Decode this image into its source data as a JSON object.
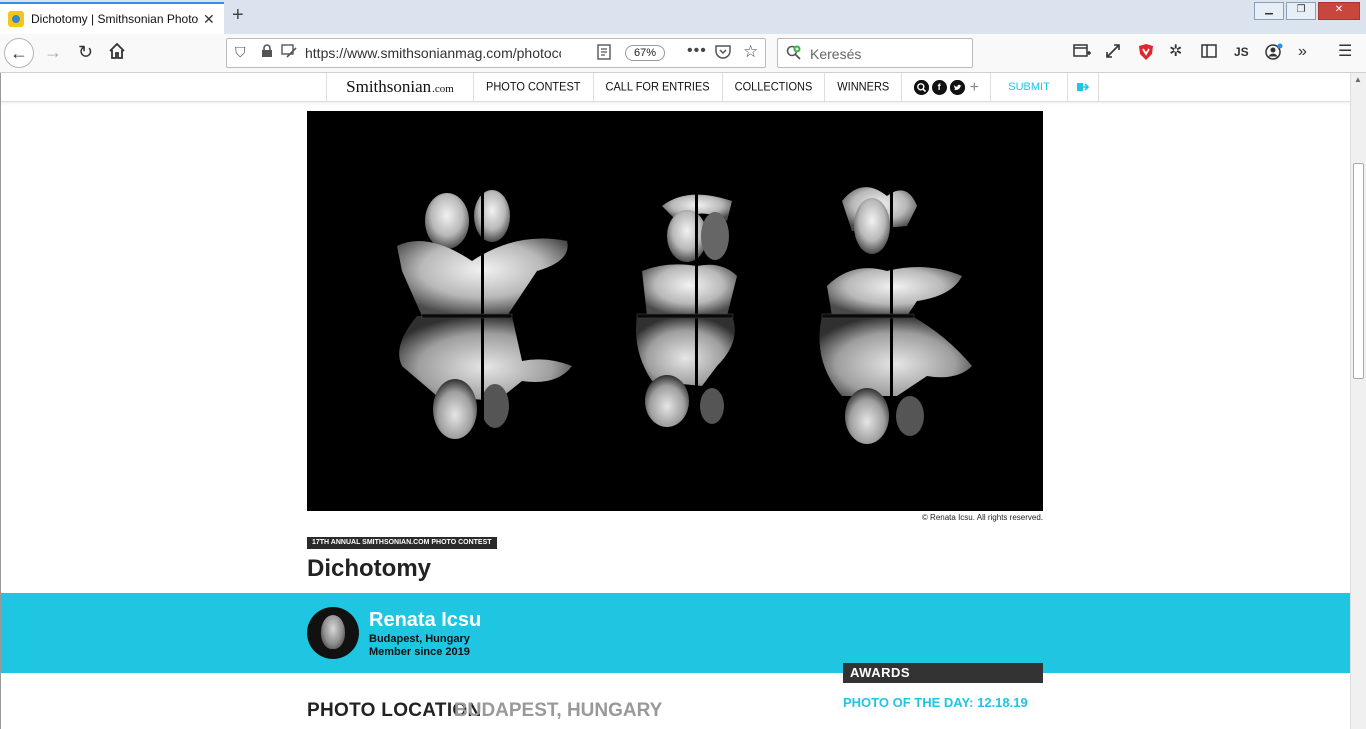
{
  "browser": {
    "tab_title": "Dichotomy | Smithsonian Photo Contest",
    "tab_close": "✕",
    "new_tab": "+",
    "url": "https://www.smithsonianmag.com/photocontest/detail/dichotomy/",
    "zoom": "67%",
    "search_placeholder": "Keresés",
    "profile_initials": "JS",
    "window_minimize": "▁",
    "window_restore": "❐",
    "window_close": "✕"
  },
  "site_nav": {
    "brand": "Smithsonian",
    "brand_suffix": ".com",
    "items": [
      "PHOTO CONTEST",
      "CALL FOR ENTRIES",
      "COLLECTIONS",
      "WINNERS"
    ],
    "submit": "SUBMIT",
    "social_plus": "+"
  },
  "photo": {
    "credit": "© Renata Icsu. All rights reserved.",
    "contest_tag": "17TH ANNUAL SMITHSONIAN.COM PHOTO CONTEST",
    "title": "Dichotomy"
  },
  "photographer": {
    "name": "Renata Icsu",
    "location": "Budapest, Hungary",
    "member_since": "Member since 2019"
  },
  "awards": {
    "heading": "AWARDS",
    "items": [
      "PHOTO OF THE DAY: 12.18.19"
    ]
  },
  "photo_location": {
    "label": "PHOTO LOCATION",
    "value": "BUDAPEST, HUNGARY"
  },
  "colors": {
    "accent": "#1ec6e2",
    "dark": "#333333"
  }
}
